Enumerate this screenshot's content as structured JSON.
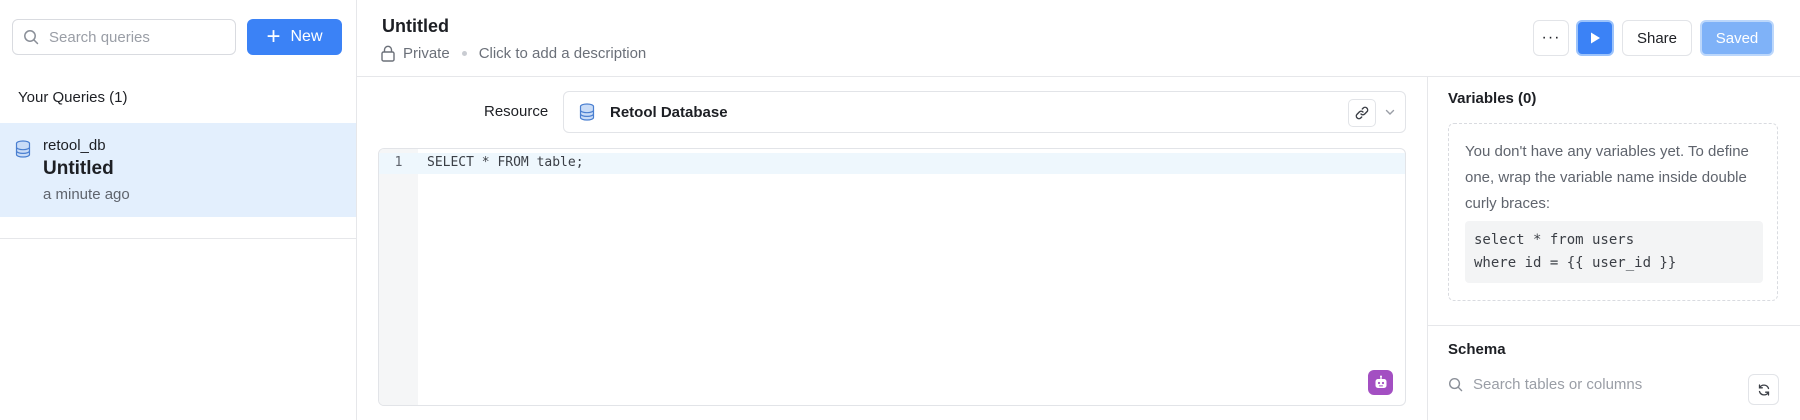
{
  "sidebar": {
    "search_placeholder": "Search queries",
    "new_label": "New",
    "section_title": "Your Queries (1)",
    "queries": [
      {
        "resource": "retool_db",
        "name": "Untitled",
        "time": "a minute ago"
      }
    ]
  },
  "header": {
    "title": "Untitled",
    "visibility": "Private",
    "description_placeholder": "Click to add a description",
    "more_label": "···",
    "share_label": "Share",
    "saved_label": "Saved"
  },
  "resource": {
    "label": "Resource",
    "value": "Retool Database"
  },
  "editor": {
    "line_number": "1",
    "code": "SELECT * FROM table;"
  },
  "variables": {
    "title": "Variables (0)",
    "empty_text": "You don't have any variables yet. To define one, wrap the variable name inside double curly braces:",
    "example_code": "select * from users\nwhere id = {{ user_id }}"
  },
  "schema": {
    "title": "Schema",
    "search_placeholder": "Search tables or columns"
  },
  "colors": {
    "accent": "#3b82f6",
    "selected_row": "#e3effd",
    "assist_purple": "#a34fc2"
  }
}
